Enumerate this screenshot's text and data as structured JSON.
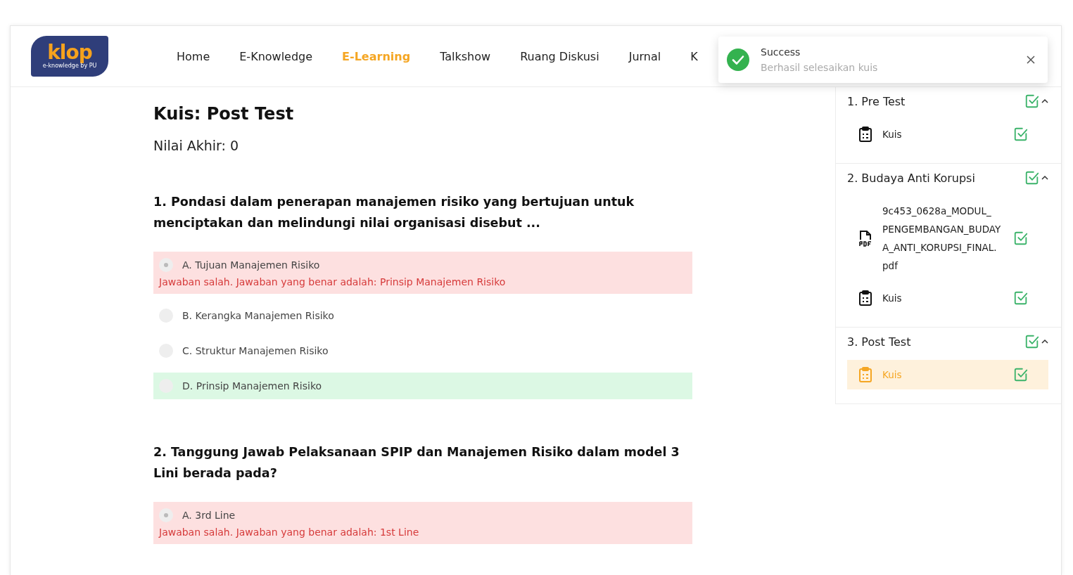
{
  "logo": {
    "wordmark": "klop",
    "tagline": "e-knowledge by PU"
  },
  "nav": [
    {
      "label": "Home",
      "selected": false
    },
    {
      "label": "E-Knowledge",
      "selected": false
    },
    {
      "label": "E-Learning",
      "selected": true
    },
    {
      "label": "Talkshow",
      "selected": false
    },
    {
      "label": "Ruang Diskusi",
      "selected": false
    },
    {
      "label": "Jurnal",
      "selected": false
    },
    {
      "label": "K",
      "selected": false
    }
  ],
  "toast": {
    "title": "Success",
    "message": "Berhasil selesaikan kuis"
  },
  "quiz": {
    "title": "Kuis: Post Test",
    "score": "Nilai Akhir: 0",
    "questions": [
      {
        "text": "1. Pondasi dalam penerapan manajemen risiko yang bertujuan untuk menciptakan dan melindungi nilai organisasi disebut ...",
        "options": [
          {
            "label": "A. Tujuan Manajemen Risiko",
            "selected": true,
            "kind": "wrong",
            "feedback": "Jawaban salah. Jawaban yang benar adalah: Prinsip Manajemen Risiko"
          },
          {
            "label": "B. Kerangka Manajemen Risiko",
            "selected": false,
            "kind": "plain"
          },
          {
            "label": "C. Struktur Manajemen Risiko",
            "selected": false,
            "kind": "plain"
          },
          {
            "label": "D. Prinsip Manajemen Risiko",
            "selected": false,
            "kind": "correct"
          }
        ]
      },
      {
        "text": "2. Tanggung Jawab Pelaksanaan SPIP dan Manajemen Risiko dalam model 3 Lini berada pada?",
        "options": [
          {
            "label": "A. 3rd Line",
            "selected": true,
            "kind": "wrong",
            "feedback": "Jawaban salah. Jawaban yang benar adalah: 1st Line"
          }
        ]
      }
    ]
  },
  "sidebar": {
    "sections": [
      {
        "title": "1. Pre Test",
        "done": true,
        "expanded": true,
        "items": [
          {
            "kind": "quiz",
            "label": "Kuis",
            "done": true,
            "selected": false
          }
        ]
      },
      {
        "title": "2. Budaya Anti Korupsi",
        "done": true,
        "expanded": true,
        "items": [
          {
            "kind": "pdf",
            "label": "9c453_0628a_MODUL_ PENGEMBANGAN_BUDAY A_ANTI_KORUPSI_FINAL. pdf",
            "done": true,
            "selected": false
          },
          {
            "kind": "quiz",
            "label": "Kuis",
            "done": true,
            "selected": false
          }
        ]
      },
      {
        "title": "3. Post Test",
        "done": true,
        "expanded": true,
        "items": [
          {
            "kind": "quiz",
            "label": "Kuis",
            "done": true,
            "selected": true
          }
        ]
      }
    ]
  }
}
